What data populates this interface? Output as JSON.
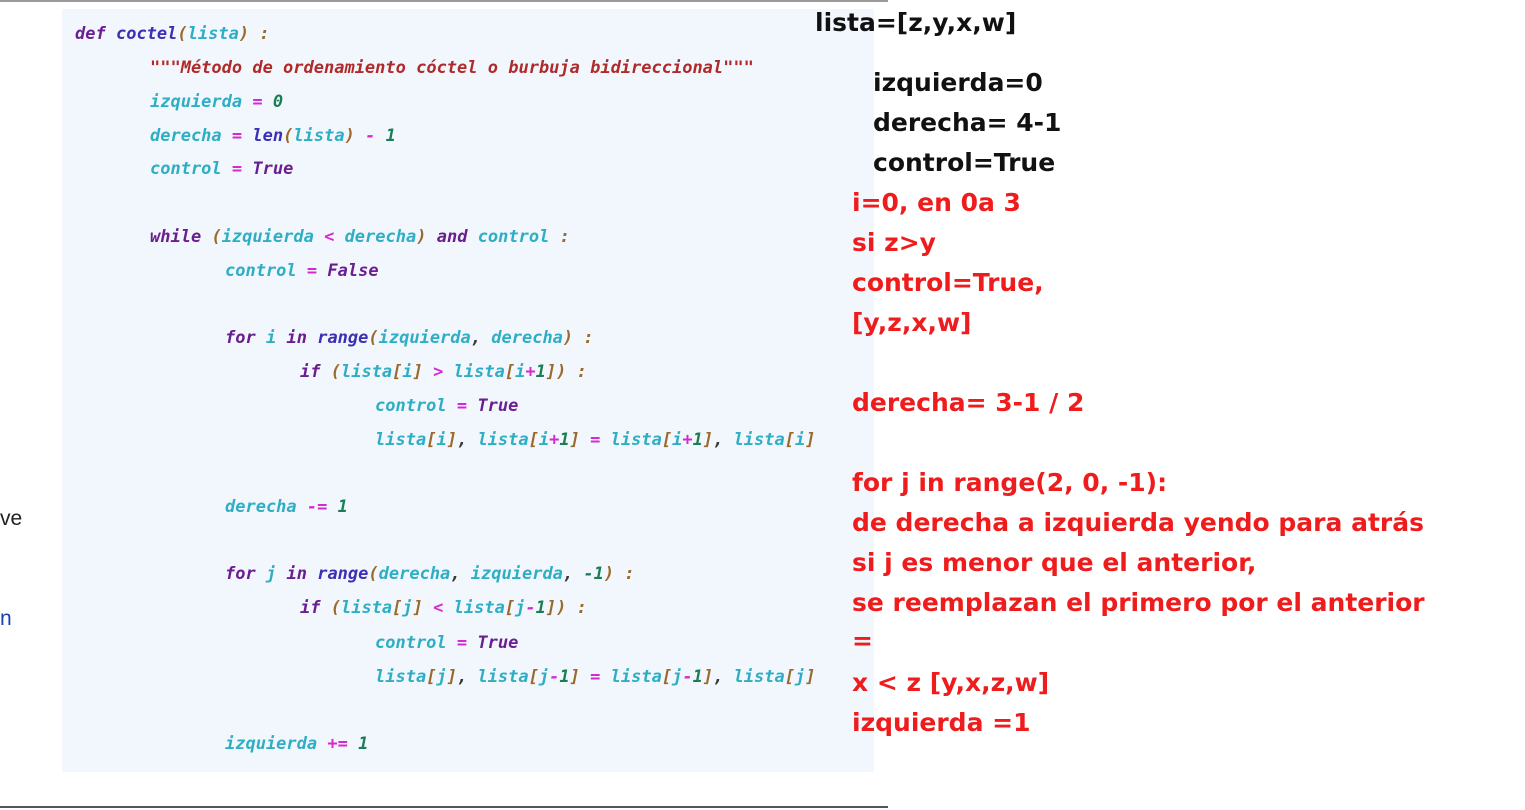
{
  "edge": {
    "text1": "ve",
    "text2": "n"
  },
  "code": {
    "l1": [
      "def",
      "coctel",
      "(",
      "lista",
      ")",
      ":"
    ],
    "l2": "\"\"\"Método de ordenamiento cóctel o burbuja bidireccional\"\"\"",
    "l3": [
      "izquierda",
      "=",
      "0"
    ],
    "l4": [
      "derecha",
      "=",
      "len",
      "(",
      "lista",
      ")",
      "-",
      "1"
    ],
    "l5": [
      "control",
      "=",
      "True"
    ],
    "l6": [
      "while",
      "(",
      "izquierda",
      "<",
      "derecha",
      ")",
      "and",
      "control",
      ":"
    ],
    "l7": [
      "control",
      "=",
      "False"
    ],
    "l8": [
      "for",
      "i",
      "in",
      "range",
      "(",
      "izquierda",
      ",",
      "derecha",
      ")",
      ":"
    ],
    "l9": [
      "if",
      "(",
      "lista",
      "[",
      "i",
      "]",
      ">",
      "lista",
      "[",
      "i",
      "+",
      "1",
      "]",
      ")",
      ":"
    ],
    "l10": [
      "control",
      "=",
      "True"
    ],
    "l11": [
      "lista",
      "[",
      "i",
      "]",
      ",",
      "lista",
      "[",
      "i",
      "+",
      "1",
      "]",
      "=",
      "lista",
      "[",
      "i",
      "+",
      "1",
      "]",
      ",",
      "lista",
      "[",
      "i",
      "]"
    ],
    "l12": [
      "derecha",
      "-=",
      "1"
    ],
    "l13": [
      "for",
      "j",
      "in",
      "range",
      "(",
      "derecha",
      ",",
      "izquierda",
      ",",
      "-1",
      ")",
      ":"
    ],
    "l14": [
      "if",
      "(",
      "lista",
      "[",
      "j",
      "]",
      "<",
      "lista",
      "[",
      "j",
      "-",
      "1",
      "]",
      ")",
      ":"
    ],
    "l15": [
      "control",
      "=",
      "True"
    ],
    "l16": [
      "lista",
      "[",
      "j",
      "]",
      ",",
      "lista",
      "[",
      "j",
      "-",
      "1",
      "]",
      "=",
      "lista",
      "[",
      "j",
      "-",
      "1",
      "]",
      ",",
      "lista",
      "[",
      "j",
      "]"
    ],
    "l17": [
      "izquierda",
      "+=",
      "1"
    ]
  },
  "notes": {
    "n1": "lista=[z,y,x,w]",
    "n2": "izquierda=0",
    "n3": "derecha= 4-1",
    "n4": "control=True",
    "n5": "i=0, en 0a 3",
    "n6": "si z>y",
    "n7": "control=True,",
    "n8": "[y,z,x,w]",
    "n9": "derecha= 3-1 / 2",
    "n10": "for j in range(2, 0, -1):",
    "n11": "de derecha a izquierda yendo para atrás",
    "n12": "si j es menor que el anterior,",
    "n13": "se reemplazan el primero por el anterior",
    "n14": "=",
    "n15": "x < z [y,x,z,w]",
    "n16": "izquierda =1"
  },
  "colors": {
    "keyword": "#6a1e8f",
    "function": "#3b2fb5",
    "variable": "#2eaec4",
    "operator": "#d42bd0",
    "number": "#1b7d55",
    "bracket": "#9a6a2c",
    "string": "#b02a2a",
    "note_black": "#111111",
    "note_red": "#ee1c1c",
    "panel_bg": "#f2f7fd"
  }
}
